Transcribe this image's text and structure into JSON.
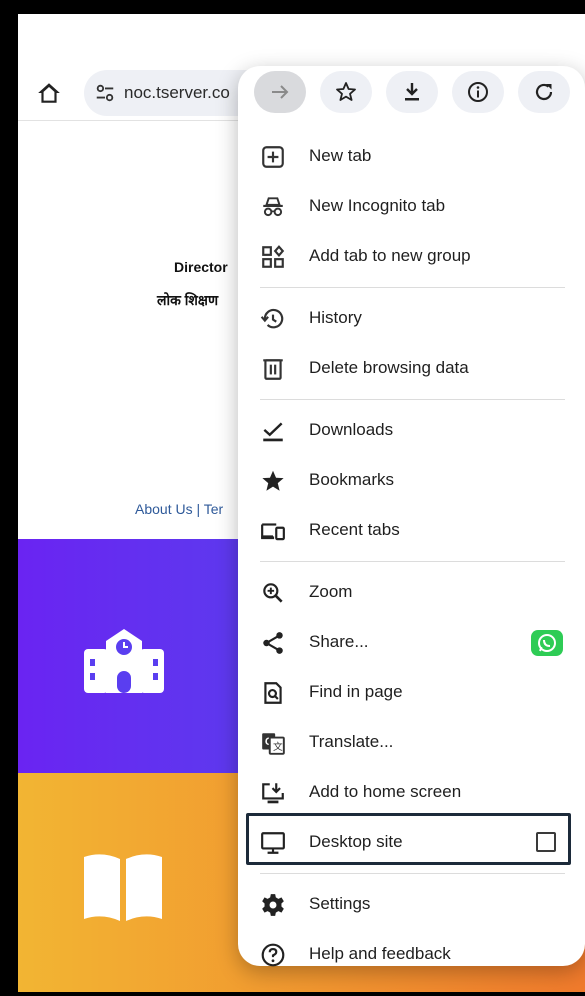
{
  "browser": {
    "url": "noc.tserver.co"
  },
  "page": {
    "dept_line1": "Director",
    "dept_line2": "लोक शिक्षण",
    "footer_links": "About Us | Ter"
  },
  "menu": {
    "top_icons": [
      {
        "icon": "forward-arrow-icon",
        "enabled": false
      },
      {
        "icon": "star-icon",
        "enabled": true
      },
      {
        "icon": "download-icon",
        "enabled": true
      },
      {
        "icon": "info-icon",
        "enabled": true
      },
      {
        "icon": "refresh-icon",
        "enabled": true
      }
    ],
    "items": [
      {
        "label": "New tab",
        "icon": "new-tab-icon"
      },
      {
        "label": "New Incognito tab",
        "icon": "incognito-icon"
      },
      {
        "label": "Add tab to new group",
        "icon": "tab-group-icon"
      },
      {
        "label": "History",
        "icon": "history-icon"
      },
      {
        "label": "Delete browsing data",
        "icon": "trash-icon"
      },
      {
        "label": "Downloads",
        "icon": "downloads-check-icon"
      },
      {
        "label": "Bookmarks",
        "icon": "bookmarks-star-icon"
      },
      {
        "label": "Recent tabs",
        "icon": "devices-icon"
      },
      {
        "label": "Zoom",
        "icon": "zoom-icon"
      },
      {
        "label": "Share...",
        "icon": "share-icon"
      },
      {
        "label": "Find in page",
        "icon": "find-in-page-icon"
      },
      {
        "label": "Translate...",
        "icon": "translate-icon"
      },
      {
        "label": "Add to home screen",
        "icon": "add-to-home-icon"
      },
      {
        "label": "Desktop site",
        "icon": "desktop-icon",
        "checked": false
      },
      {
        "label": "Settings",
        "icon": "gear-icon"
      },
      {
        "label": "Help and feedback",
        "icon": "help-icon"
      }
    ],
    "share_app_icon": "whatsapp-icon"
  },
  "colors": {
    "banner_blue": "#6a24f2",
    "banner_orange": "#f2b533",
    "highlight_border": "#1c2a3a",
    "whatsapp_green": "#2ecc55"
  }
}
